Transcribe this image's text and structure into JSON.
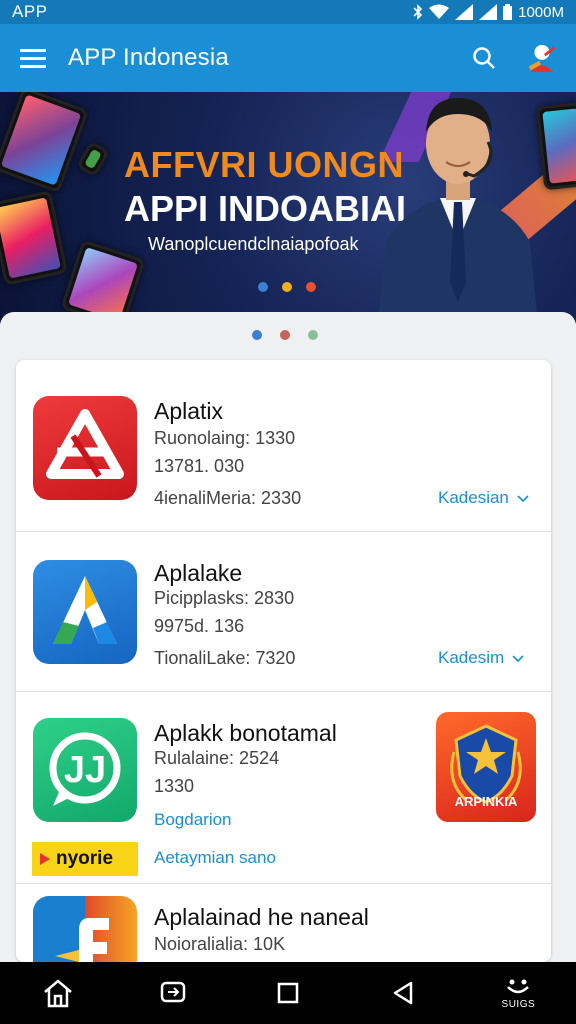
{
  "status_bar": {
    "label": "APP",
    "time": "1000M"
  },
  "app_bar": {
    "title": "APP Indonesia",
    "menu_icon": "menu-icon",
    "search_icon": "search-icon",
    "profile_icon": "profile-icon"
  },
  "banner": {
    "headline_1": "AFFVRI UONGN",
    "headline_2": "APPI INDOABIAI",
    "tagline": "Wanoplcuendclnaiapofoak",
    "dot_colors": [
      "#3d7fd1",
      "#f2b01e",
      "#e8502e"
    ]
  },
  "pager": {
    "dot_colors": [
      "#3d7fd1",
      "#c0665a",
      "#8bbf9a"
    ]
  },
  "apps": [
    {
      "name": "Aplatix",
      "line1": "Ruonolaing: 1330",
      "line2": "13781. 030",
      "line3": "4ienaliMeria: 2330",
      "action": "Kadesian"
    },
    {
      "name": "Aplalake",
      "line1": "Picipplasks: 2830",
      "line2": "9975d. 136",
      "line3": "TionaliLake: 7320",
      "action": "Kadesim"
    },
    {
      "name": "Aplakk bonotamal",
      "line1": "Rulalaine: 2524",
      "line2": "1330",
      "line3": "Bogdarion",
      "badge": "nyorie",
      "action": "Aetaymian sano",
      "promo_label": "ARPINKIA"
    },
    {
      "name": "Aplalainad he naneal",
      "line1": "Noioralialia: 10K",
      "line2": "",
      "line3": ""
    }
  ],
  "nav_bar": {
    "home": "home-icon",
    "recent": "recent-apps-icon",
    "square": "square-icon",
    "back": "back-icon",
    "extra_label": "SUIGS"
  }
}
